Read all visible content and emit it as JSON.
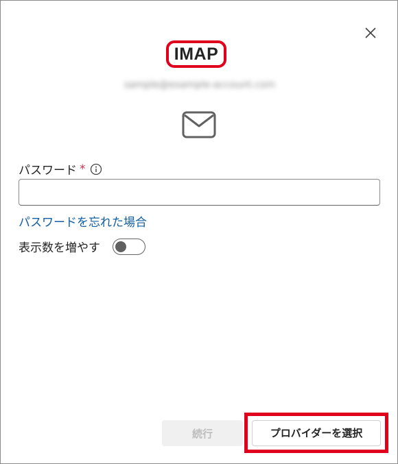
{
  "dialog": {
    "title": "IMAP",
    "account_email": "sample@example-account.com",
    "close_icon": "close-icon",
    "mail_icon": "mail-icon"
  },
  "password": {
    "label": "パスワード",
    "required_mark": "*",
    "info_icon": "info-icon",
    "value": "",
    "forgot_link": "パスワードを忘れた場合"
  },
  "more_toggle": {
    "label": "表示数を増やす",
    "state": "off"
  },
  "footer": {
    "continue_label": "続行",
    "choose_provider_label": "プロバイダーを選択"
  },
  "colors": {
    "highlight": "#e0001b",
    "link": "#115ea3",
    "required": "#c4314b"
  }
}
